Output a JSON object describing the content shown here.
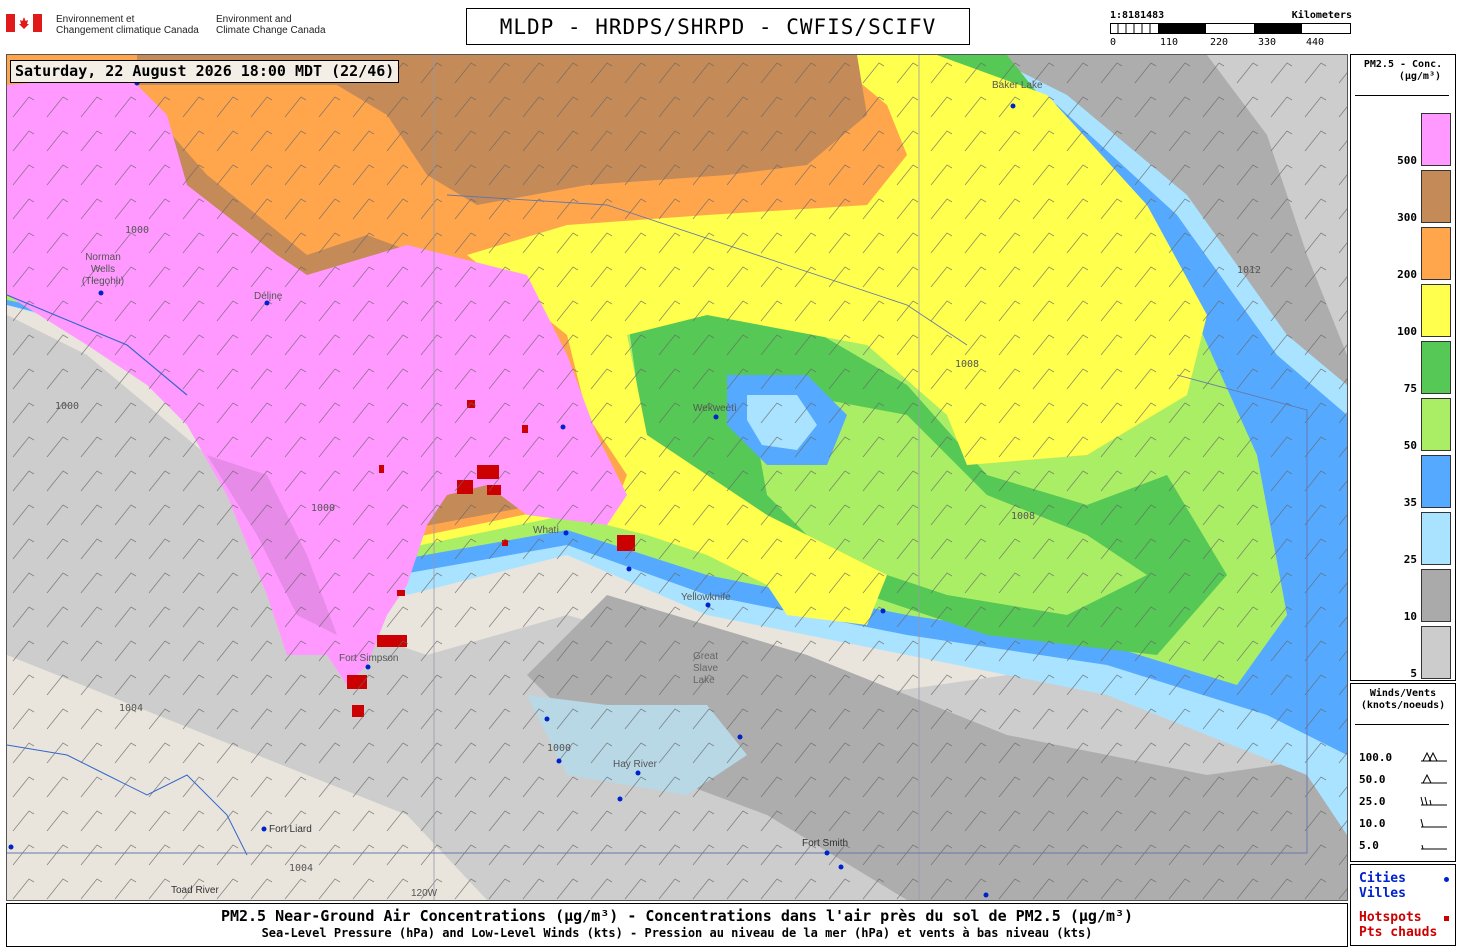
{
  "header": {
    "gov_fr_line1": "Environnement et",
    "gov_fr_line2": "Changement climatique Canada",
    "gov_en_line1": "Environment and",
    "gov_en_line2": "Climate Change Canada",
    "title": "MLDP - HRDPS/SHRPD - CWFIS/SCIFV",
    "scale_ratio": "1:8181483",
    "scale_unit": "Kilometers",
    "scale_ticks": [
      "0",
      "110",
      "220",
      "330",
      "440"
    ]
  },
  "map": {
    "timestamp": "Saturday, 22 August 2026 18:00 MDT (22/46)",
    "places": [
      {
        "name": "Norman Wells (Tłegǫhłı)"
      },
      {
        "name": "Délįnę"
      },
      {
        "name": "Whatì"
      },
      {
        "name": "Wekweètì"
      },
      {
        "name": "Yellowknife"
      },
      {
        "name": "Great Slave Lake"
      },
      {
        "name": "Fort Simpson"
      },
      {
        "name": "Hay River"
      },
      {
        "name": "Fort Liard"
      },
      {
        "name": "Fort Smith"
      },
      {
        "name": "Toad River"
      },
      {
        "name": "Baker Lake"
      },
      {
        "name": "120W"
      }
    ],
    "isobars": [
      "1000",
      "1004",
      "1008",
      "1012"
    ]
  },
  "legend_pm": {
    "title_line1": "PM2.5 - Conc.",
    "title_line2": "(µg/m³)",
    "levels": [
      {
        "label": "500",
        "color": "#ff99ff"
      },
      {
        "label": "300",
        "color": "#c48a58"
      },
      {
        "label": "200",
        "color": "#ffa64d"
      },
      {
        "label": "100",
        "color": "#ffff4d"
      },
      {
        "label": "75",
        "color": "#55c855"
      },
      {
        "label": "50",
        "color": "#aaee66"
      },
      {
        "label": "35",
        "color": "#55aaff"
      },
      {
        "label": "25",
        "color": "#aae3ff"
      },
      {
        "label": "10",
        "color": "#aaaaaa"
      },
      {
        "label": "5",
        "color": "#cccccc"
      }
    ]
  },
  "legend_wind": {
    "title_line1": "Winds/Vents",
    "title_line2": "(knots/noeuds)",
    "speeds": [
      "100.0",
      "50.0",
      "25.0",
      "10.0",
      "5.0"
    ]
  },
  "legend_points": {
    "cities_en": "Cities",
    "cities_fr": "Villes",
    "hotspots_en": "Hotspots",
    "hotspots_fr": "Pts chauds",
    "city_color": "#0022cc",
    "hotspot_color": "#cc0000"
  },
  "caption": {
    "line1": "PM2.5 Near-Ground Air Concentrations (µg/m³) - Concentrations dans l'air près du sol de PM2.5 (µg/m³)",
    "line2": "Sea-Level Pressure (hPa) and Low-Level Winds (kts) - Pression au niveau de la mer (hPa) et vents à bas niveau (kts)"
  }
}
